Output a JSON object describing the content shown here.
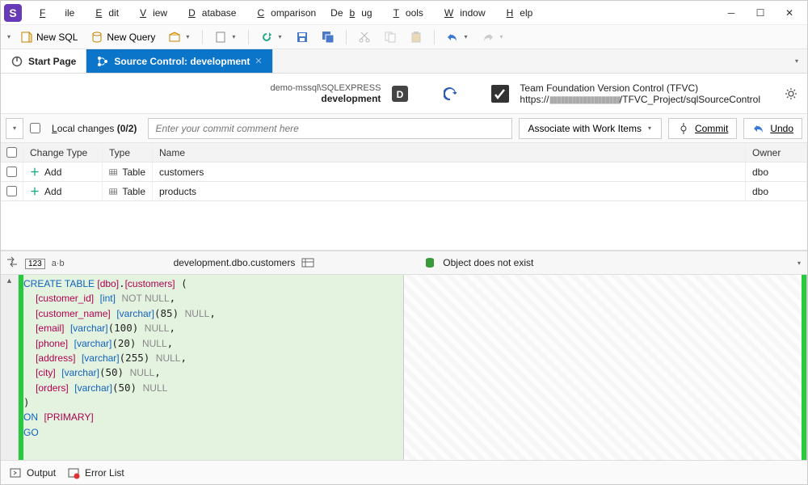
{
  "menu": {
    "file": "File",
    "edit": "Edit",
    "view": "View",
    "database": "Database",
    "comparison": "Comparison",
    "debug": "Debug",
    "tools": "Tools",
    "window": "Window",
    "help": "Help"
  },
  "toolbar": {
    "new_sql": "New SQL",
    "new_query": "New Query"
  },
  "tabs": {
    "start": "Start Page",
    "source": "Source Control: development"
  },
  "info": {
    "server": "demo-mssql\\SQLEXPRESS",
    "db": "development",
    "vcs_title": "Team Foundation Version Control (TFVC)",
    "vcs_prefix": "https://",
    "vcs_blurred": "▮▮▮▮▮▮▮▮▮▮▮▮▮▮▮▮▮▮▮",
    "vcs_suffix": "/TFVC_Project/sqlSourceControl"
  },
  "commitbar": {
    "local_label": "Local changes",
    "count": "(0/2)",
    "placeholder": "Enter your commit comment here",
    "associate": "Associate with Work Items",
    "commit": "Commit",
    "undo": "Undo"
  },
  "grid": {
    "headers": {
      "change": "Change Type",
      "type": "Type",
      "name": "Name",
      "owner": "Owner"
    },
    "rows": [
      {
        "change": "Add",
        "type": "Table",
        "name": "customers",
        "owner": "dbo"
      },
      {
        "change": "Add",
        "type": "Table",
        "name": "products",
        "owner": "dbo"
      }
    ]
  },
  "midbar": {
    "object": "development.dbo.customers",
    "right_status": "Object does not exist"
  },
  "sql": "CREATE TABLE [dbo].[customers] (\n  [customer_id] [int] NOT NULL,\n  [customer_name] [varchar](85) NULL,\n  [email] [varchar](100) NULL,\n  [phone] [varchar](20) NULL,\n  [address] [varchar](255) NULL,\n  [city] [varchar](50) NULL,\n  [orders] [varchar](50) NULL\n)\nON [PRIMARY]\nGO",
  "status": {
    "output": "Output",
    "errors": "Error List"
  }
}
